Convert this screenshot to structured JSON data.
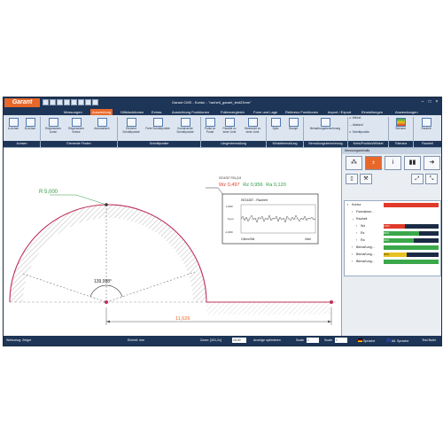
{
  "app": {
    "logo_text": "Garant",
    "window_title": "Garant CMS - Kontur - \"rauheit_garant_test23mm\""
  },
  "menus": [
    "Messungen",
    "Auswertung",
    "Hilfsfunktionen",
    "Extras",
    "Ausrichtung Funktionen",
    "Folienvergleich",
    "Form und Lage",
    "Referenz Funktionen",
    "Import / Export",
    "Einstellungen",
    "Anwendungen"
  ],
  "active_menu": "Auswertung",
  "ribbon": {
    "buttons": [
      {
        "label": "A-Achse",
        "icon": "axis-a-icon"
      },
      {
        "label": "B-Achse",
        "icon": "axis-b-icon"
      },
      {
        "label": "Regressions Linien",
        "icon": "regression-line-icon"
      },
      {
        "label": "Regressions Kreise",
        "icon": "regression-circle-icon"
      },
      {
        "label": "Automatisch",
        "icon": "automatic-icon"
      },
      {
        "label": "Element Schnittpunkte",
        "icon": "element-intersection-icon"
      },
      {
        "label": "Freie Schnittpunkte",
        "icon": "free-intersection-icon"
      },
      {
        "label": "Konstruierte Schnittpunkte",
        "icon": "constructed-intersection-icon"
      },
      {
        "label": "Punkt zu Punkt",
        "icon": "point-to-point-icon"
      },
      {
        "label": "Parallel zu einer Linie",
        "icon": "parallel-line-icon"
      },
      {
        "label": "Senkrecht zu einer Linie",
        "icon": "perpendicular-line-icon"
      },
      {
        "label": "Spitz",
        "icon": "acute-angle-icon"
      },
      {
        "label": "Stumpf",
        "icon": "obtuse-angle-icon"
      },
      {
        "label": "Bemaßungsberechnung",
        "icon": "dimension-calc-icon"
      },
      {
        "label": "Winkel",
        "icon": "angle-icon"
      },
      {
        "label": "Abstand",
        "icon": "distance-icon"
      },
      {
        "label": "Schnittpunkte",
        "icon": "intersection-icon"
      },
      {
        "label": "Toleranz",
        "icon": "tolerance-icon"
      },
      {
        "label": "Rauheit",
        "icon": "roughness-icon"
      }
    ],
    "groups": [
      "Achsen",
      "Elemente Finden",
      "Schnittpunkte",
      "Längenbemaßung",
      "Winkelbemaßung",
      "Bemaßungsberechnung",
      "Kreis/Position/Winkel",
      "Toleranz",
      "Rauheit"
    ]
  },
  "drawing": {
    "radius_label": "R 5,000",
    "angle_label": "139,998°",
    "length_label": "11,626",
    "iso_small": "ISO4287 RSL(0,8",
    "roughness_values": {
      "wz": "Wz 0,497",
      "rz": "Rz 0,956",
      "ra": "Ra 0,120"
    },
    "inset_title": "ISO4287 - Rauheit",
    "inset_y_top": "1,000",
    "inset_y_mid": "0 µm",
    "inset_y_bot": "-1,000",
    "inset_x_left": "0,8mm/Skt",
    "inset_x_right": "4mm",
    "colors": {
      "arc": "#c0305a",
      "green": "#2e9a45",
      "orange": "#e8682a",
      "hatch": "#b8b8b8"
    }
  },
  "side_panel": {
    "title": "Messungsdetails",
    "tree": [
      {
        "label": "Kontur",
        "indent": 0,
        "bar": "#e03a2a",
        "bar_text": ""
      },
      {
        "label": "Formabwe...",
        "indent": 1,
        "bar": "",
        "bar_text": ""
      },
      {
        "label": "Rauheit",
        "indent": 1,
        "bar": "",
        "bar_text": ""
      },
      {
        "label": "Wz",
        "indent": 2,
        "bar": "#e03a2a",
        "bar_text": "0,9%"
      },
      {
        "label": "Rz",
        "indent": 2,
        "bar": "#3aa84a",
        "bar_text": "80%"
      },
      {
        "label": "Ra",
        "indent": 2,
        "bar": "#3aa84a",
        "bar_text": "60%"
      },
      {
        "label": "Bemaßung...",
        "indent": 1,
        "bar": "",
        "bar_text": ""
      },
      {
        "label": "Bemaßung...",
        "indent": 1,
        "bar": "#e8c020",
        "bar_text": "20%"
      },
      {
        "label": "Bemaßung...",
        "indent": 1,
        "bar": "#3aa84a",
        "bar_text": ""
      }
    ]
  },
  "status": {
    "tool": "Werkzeug: Zeiger",
    "unit": "Einheit: mm",
    "zoom_label": "Zoom: [331,2x]",
    "zoom_value": "15,00",
    "display": "Anzeige optimieren",
    "scale1_label": "Scale",
    "scale1_value": "1",
    "scale2_label": "Scale",
    "scale2_value": "1",
    "lang1": "Sprache",
    "lang2": "Alt. Sprache",
    "build": "Test Build"
  }
}
